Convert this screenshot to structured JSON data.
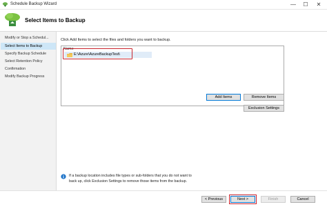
{
  "window": {
    "title": "Schedule Backup Wizard",
    "minimize_glyph": "—",
    "maximize_glyph": "☐",
    "close_glyph": "✕"
  },
  "header": {
    "title": "Select Items to Backup"
  },
  "steps": [
    {
      "label": "Modify or Stop a Schedul...",
      "active": false
    },
    {
      "label": "Select Items to Backup",
      "active": true
    },
    {
      "label": "Specify Backup Schedule",
      "active": false
    },
    {
      "label": "Select Retention Policy",
      "active": false
    },
    {
      "label": "Confirmation",
      "active": false
    },
    {
      "label": "Modify Backup Progress",
      "active": false
    }
  ],
  "main": {
    "instruction": "Click Add Items to select the files and folders you want to backup.",
    "list": {
      "column_header": "Name",
      "items": [
        {
          "path": "E:\\Azure\\AzureBackupTest\\",
          "icon": "folder-icon"
        }
      ]
    },
    "buttons": {
      "add_items": "Add Items",
      "remove_items": "Remove Items",
      "exclusion_settings": "Exclusion Settings"
    },
    "info_line1": "If a backup location includes file types or sub-folders that you do not want to",
    "info_line2": "back up, click Exclusion Settings to remove those items from the backup."
  },
  "footer": {
    "previous": "< Previous",
    "next": "Next >",
    "finish": "Finish",
    "cancel": "Cancel"
  },
  "colors": {
    "accent": "#0078d7",
    "highlight": "#c8232c",
    "selected_step": "#cde6f7"
  }
}
